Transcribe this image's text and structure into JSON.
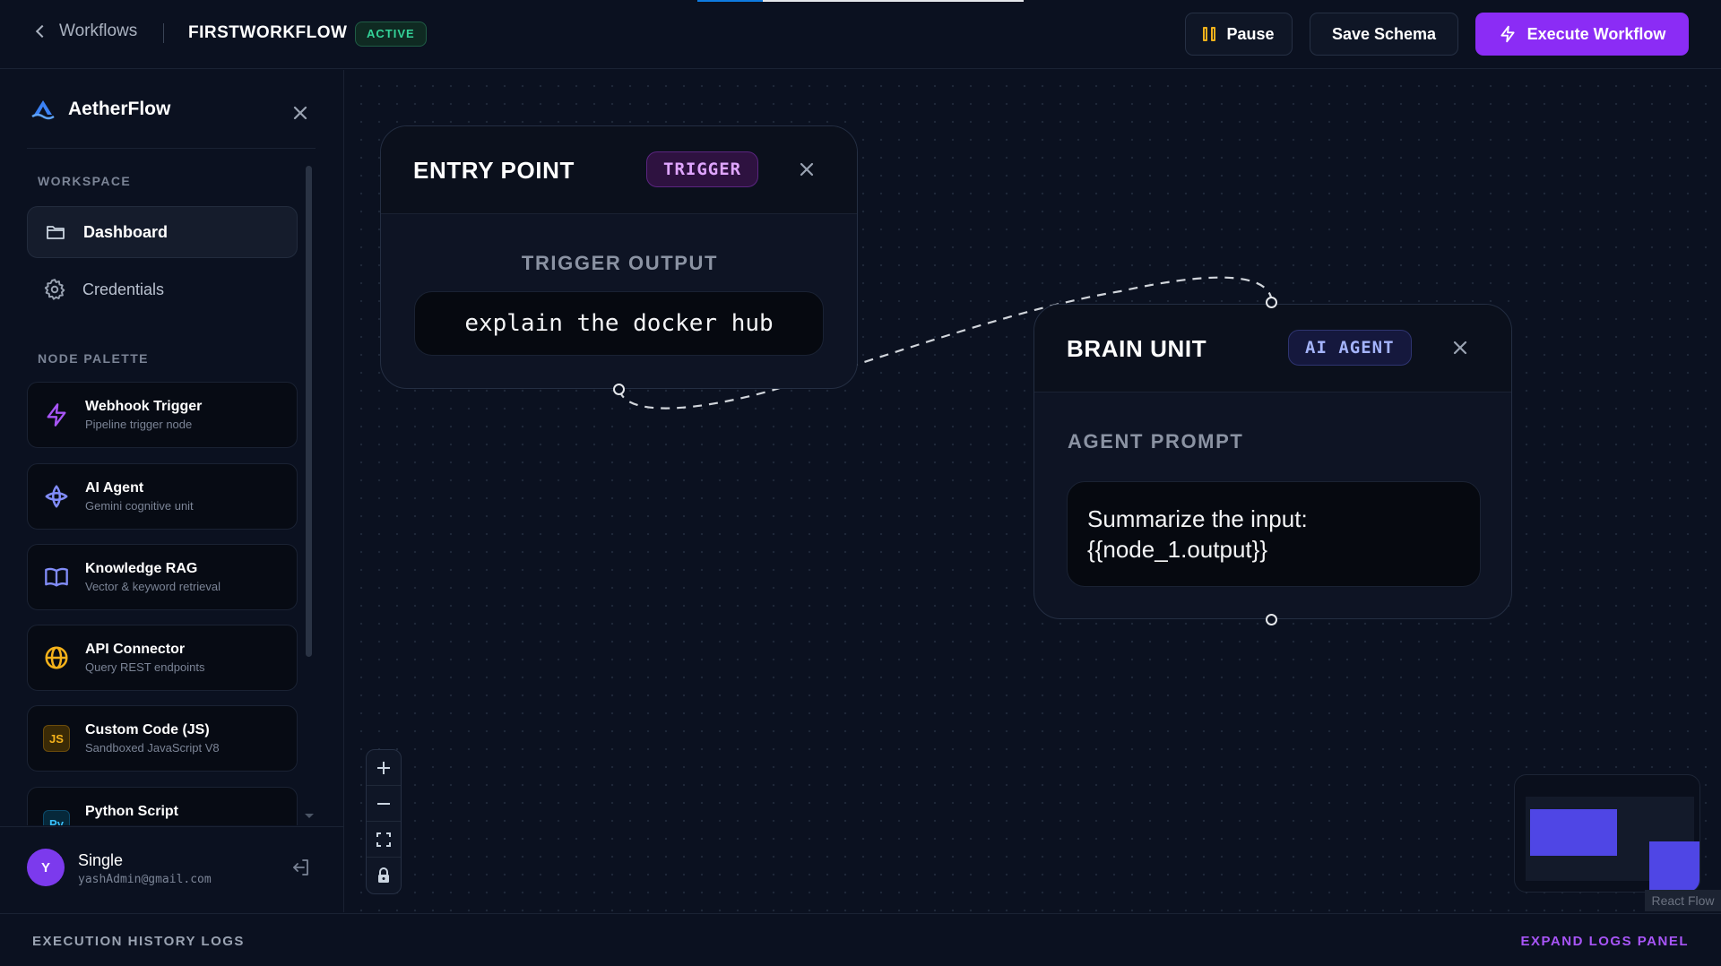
{
  "header": {
    "back_label": "Workflows",
    "workflow_name": "FIRSTWORKFLOW",
    "status_badge": "ACTIVE",
    "pause_label": "Pause",
    "save_label": "Save Schema",
    "execute_label": "Execute Workflow",
    "progress_percent": 20
  },
  "sidebar": {
    "brand": "AetherFlow",
    "workspace_title": "WORKSPACE",
    "nav": [
      {
        "label": "Dashboard",
        "icon": "folder-icon",
        "active": true
      },
      {
        "label": "Credentials",
        "icon": "gear-icon",
        "active": false
      }
    ],
    "palette_title": "NODE PALETTE",
    "palette": [
      {
        "title": "Webhook Trigger",
        "subtitle": "Pipeline trigger node",
        "icon": "lightning-icon"
      },
      {
        "title": "AI Agent",
        "subtitle": "Gemini cognitive unit",
        "icon": "brain-icon"
      },
      {
        "title": "Knowledge RAG",
        "subtitle": "Vector & keyword retrieval",
        "icon": "book-icon"
      },
      {
        "title": "API Connector",
        "subtitle": "Query REST endpoints",
        "icon": "globe-icon"
      },
      {
        "title": "Custom Code (JS)",
        "subtitle": "Sandboxed JavaScript V8",
        "icon": "js-icon",
        "icon_text": "JS"
      },
      {
        "title": "Python Script",
        "subtitle": "",
        "icon": "python-icon",
        "icon_text": "Py"
      }
    ],
    "user": {
      "initial": "Y",
      "name": "Single",
      "email": "yashAdmin@gmail.com"
    }
  },
  "nodes": {
    "entry": {
      "title": "ENTRY POINT",
      "badge": "TRIGGER",
      "field_label": "TRIGGER OUTPUT",
      "field_value": "explain the docker hub"
    },
    "brain": {
      "title": "BRAIN UNIT",
      "badge": "AI AGENT",
      "field_label": "AGENT PROMPT",
      "field_value_line1": "Summarize the input:",
      "field_value_line2": "{{node_1.output}}"
    }
  },
  "minimap": {
    "attribution": "React Flow"
  },
  "footer": {
    "left": "EXECUTION HISTORY LOGS",
    "right": "EXPAND LOGS PANEL"
  },
  "colors": {
    "accent": "#8b2cf5",
    "active": "#34d399",
    "minimap_node": "#4f46e5"
  }
}
